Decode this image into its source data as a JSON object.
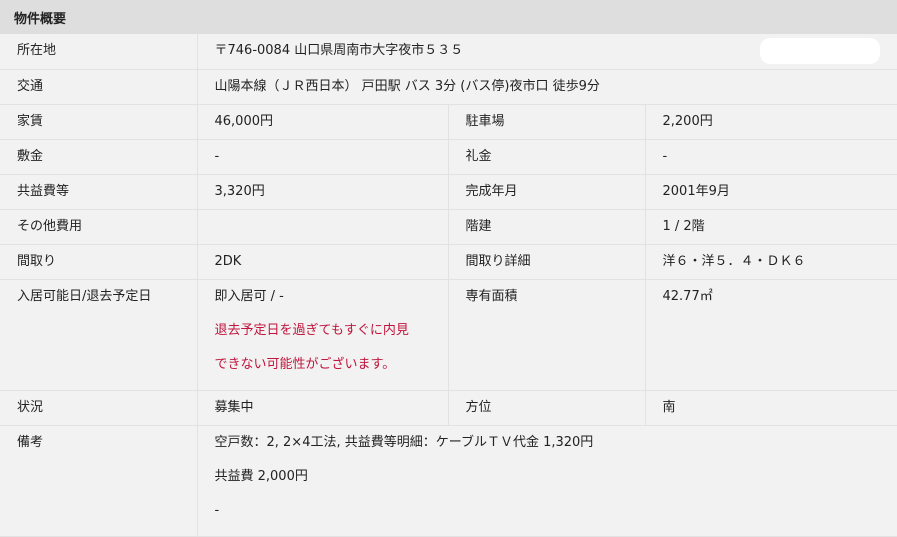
{
  "header": {
    "title": "物件概要"
  },
  "rows": {
    "address": {
      "label": "所在地",
      "value": "〒746-0084 山口県周南市大字夜市５３５"
    },
    "transport": {
      "label": "交通",
      "value": "山陽本線（ＪＲ西日本） 戸田駅 バス 3分 (バス停)夜市口 徒歩9分"
    },
    "rent": {
      "label": "家賃",
      "value": "46,000円",
      "label2": "駐車場",
      "value2": "2,200円"
    },
    "deposit": {
      "label": "敷金",
      "value": "-",
      "label2": "礼金",
      "value2": "-"
    },
    "common_fee": {
      "label": "共益費等",
      "value": "3,320円",
      "label2": "完成年月",
      "value2": "2001年9月"
    },
    "other_fee": {
      "label": "その他費用",
      "value": "",
      "label2": "階建",
      "value2": "1 / 2階"
    },
    "layout": {
      "label": "間取り",
      "value": "2DK",
      "label2": "間取り詳細",
      "value2": "洋６・洋５．４・ＤＫ６"
    },
    "move_in": {
      "label": "入居可能日/退去予定日",
      "value": "即入居可 / -",
      "warning_line1": "退去予定日を過ぎてもすぐに内見",
      "warning_line2": "できない可能性がございます。",
      "label2": "専有面積",
      "value2": "42.77㎡"
    },
    "status": {
      "label": "状況",
      "value": "募集中",
      "label2": "方位",
      "value2": "南"
    },
    "remarks": {
      "label": "備考",
      "line1": "空戸数：2, 2×4工法, 共益費等明細：ケーブルＴＶ代金 1,320円",
      "line2": "共益費 2,000円",
      "line3": "-"
    }
  }
}
